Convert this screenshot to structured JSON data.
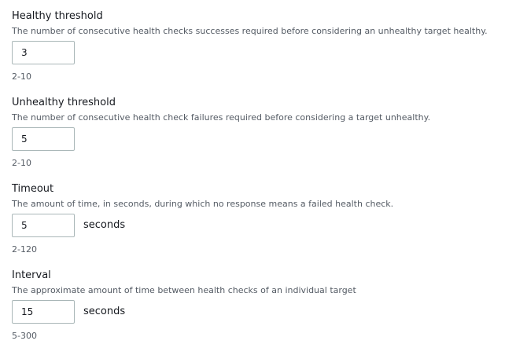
{
  "fields": {
    "healthy_threshold": {
      "label": "Healthy threshold",
      "description": "The number of consecutive health checks successes required before considering an unhealthy target healthy.",
      "value": "3",
      "unit": "",
      "hint": "2-10"
    },
    "unhealthy_threshold": {
      "label": "Unhealthy threshold",
      "description": "The number of consecutive health check failures required before considering a target unhealthy.",
      "value": "5",
      "unit": "",
      "hint": "2-10"
    },
    "timeout": {
      "label": "Timeout",
      "description": "The amount of time, in seconds, during which no response means a failed health check.",
      "value": "5",
      "unit": "seconds",
      "hint": "2-120"
    },
    "interval": {
      "label": "Interval",
      "description": "The approximate amount of time between health checks of an individual target",
      "value": "15",
      "unit": "seconds",
      "hint": "5-300"
    }
  }
}
